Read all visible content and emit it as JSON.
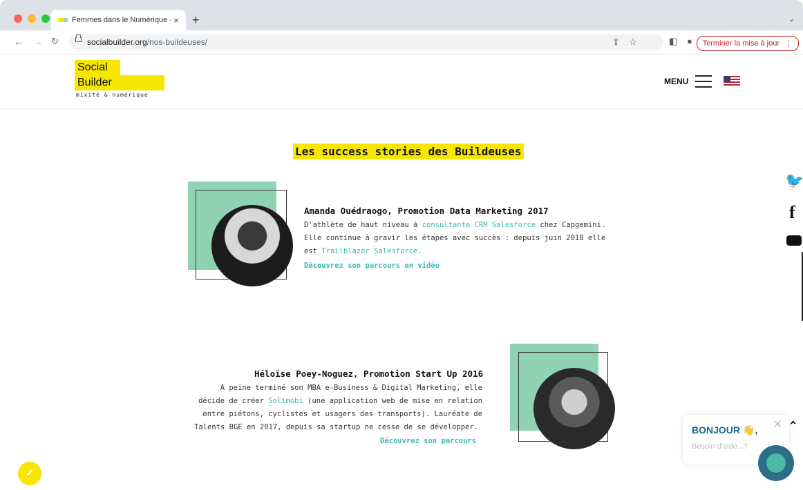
{
  "browser": {
    "tab_title": "Femmes dans le Numérique - S",
    "tab_close": "×",
    "new_tab": "+",
    "url_host": "socialbuilder.org",
    "url_path": "/nos-buildeuses/",
    "update_button": "Terminer la mise à jour",
    "update_menu": "⋮",
    "traffic_colors": [
      "#ff5f57",
      "#febc2e",
      "#28c840"
    ]
  },
  "site": {
    "logo_line1": "Social",
    "logo_line2": "Builder",
    "logo_tagline": "mixité & numérique",
    "menu_label": "MENU",
    "brand_yellow": "#f7e600",
    "accent_teal": "#3bb8b0",
    "accent_green": "#8fd3b4"
  },
  "section": {
    "title": "Les success stories des Buildeuses"
  },
  "stories": [
    {
      "name": "Amanda Ouédraogo, Promotion Data Marketing 2017",
      "line1_a": "D'athlète de haut niveau à ",
      "line1_link": "consultante CRM Salesforce",
      "line1_b": " chez Capgemini.",
      "line2": "Elle continue à gravir les étapes avec succès : depuis juin 2018 elle",
      "line3_a": "est ",
      "line3_link": "Trailblazer Salesforce.",
      "cta": "Découvrez son parcours en vidéo"
    },
    {
      "name": "Héloïse Poey-Noguez, Promotion Start Up 2016",
      "line1": "A peine terminé son MBA e-Business & Digital Marketing, elle",
      "line2_a": "décide de créer ",
      "line2_link": "Solimobi",
      "line2_b": " (une application web de mise en relation",
      "line3": "entre piétons, cyclistes et usagers des transports). Lauréate de",
      "line4": "Talents BGE en 2017, depuis sa startup ne cesse de se développer.",
      "cta": "Découvrez son parcours"
    }
  ],
  "chat": {
    "title": "BONJOUR 👋,",
    "subtitle": "Besoin d'aide...?",
    "close": "✕"
  },
  "social_icons": [
    "twitter-icon",
    "facebook-icon",
    "youtube-icon"
  ]
}
